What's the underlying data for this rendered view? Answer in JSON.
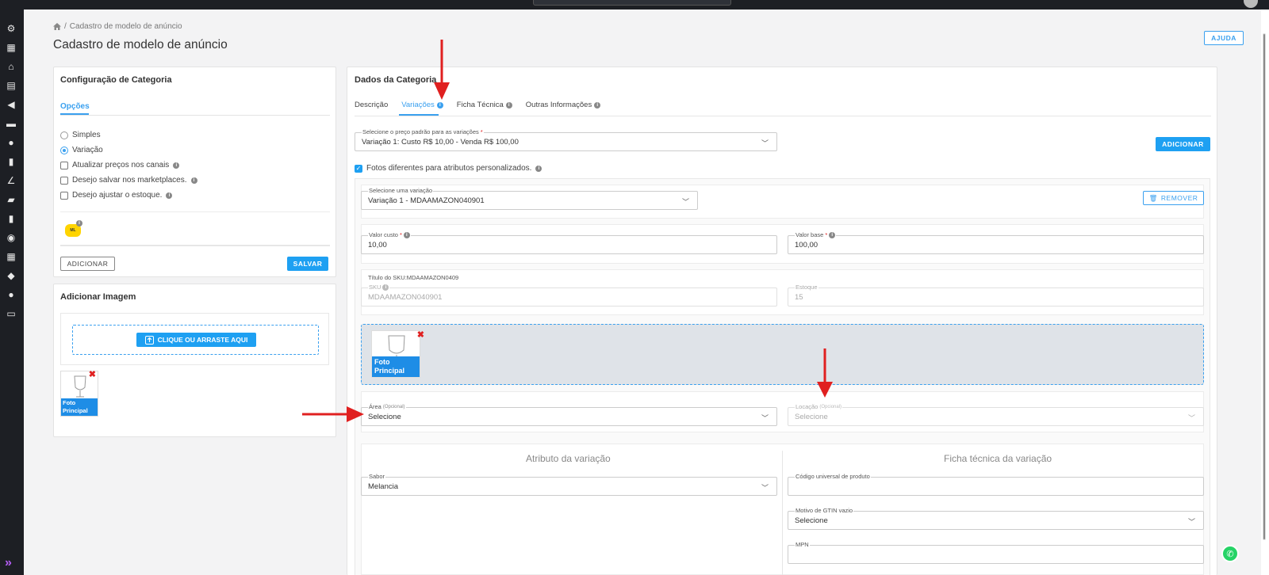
{
  "breadcrumb": {
    "current": "Cadastro de modelo de anúncio"
  },
  "page": {
    "title": "Cadastro de modelo de anúncio",
    "help_label": "AJUDA"
  },
  "category_config": {
    "title": "Configuração de Categoria",
    "tab_label": "Opções",
    "options": {
      "simple": "Simples",
      "variation": "Variação",
      "update_prices": "Atualizar preços nos canais",
      "save_marketplaces": "Desejo salvar nos marketplaces.",
      "adjust_stock": "Desejo ajustar o estoque."
    },
    "add_button": "ADICIONAR",
    "save_button": "SALVAR"
  },
  "add_image": {
    "title": "Adicionar Imagem",
    "upload_label": "CLIQUE OU ARRASTE AQUI",
    "thumb_tag": "Foto Principal"
  },
  "category_data": {
    "title": "Dados da Categoria",
    "tabs": [
      "Descrição",
      "Variações",
      "Ficha Técnica",
      "Outras Informações"
    ],
    "default_price": {
      "label": "Selecione o preço padrão para as variações",
      "value": "Variação 1: Custo R$ 10,00 - Venda R$ 100,00"
    },
    "add_button": "ADICIONAR",
    "custom_photos_label": "Fotos diferentes para atributos personalizados.",
    "variation_select": {
      "label": "Selecione uma variação",
      "value": "Variação 1 - MDAAMAZON040901"
    },
    "remove_button": "REMOVER",
    "cost": {
      "label": "Valor custo",
      "value": "10,00"
    },
    "base": {
      "label": "Valor base",
      "value": "100,00"
    },
    "sku_title": "Título do SKU:MDAAMAZON0409",
    "sku": {
      "label": "SKU",
      "value": "MDAAMAZON040901"
    },
    "stock": {
      "label": "Estoque",
      "value": "15"
    },
    "photo_tag": "Foto Principal",
    "area": {
      "label": "Área",
      "optional": "(Opcional)",
      "value": "Selecione"
    },
    "location": {
      "label": "Locação",
      "optional": "(Opcional)",
      "value": "Selecione"
    },
    "attr_title": "Atributo da variação",
    "sheet_title": "Ficha técnica da variação",
    "flavor": {
      "label": "Sabor",
      "value": "Melancia"
    },
    "upc": {
      "label": "Código universal de produto",
      "value": ""
    },
    "gtin_reason": {
      "label": "Motivo de GTIN vazio",
      "value": "Selecione"
    },
    "mpn": {
      "label": "MPN",
      "value": ""
    }
  },
  "colors": {
    "accent": "#1ea0f2",
    "sidebar": "#1d1f24",
    "arrow": "#e02020"
  },
  "icons": [
    "settings-icon",
    "store-icon",
    "bank-icon",
    "archive-icon",
    "megaphone-icon",
    "cart-icon",
    "chat-icon",
    "excel-icon",
    "chart-icon",
    "truck-icon",
    "invoice-icon",
    "search-icon",
    "calculator-icon",
    "shield-icon",
    "users-icon",
    "server-icon",
    "whatsapp-icon"
  ]
}
